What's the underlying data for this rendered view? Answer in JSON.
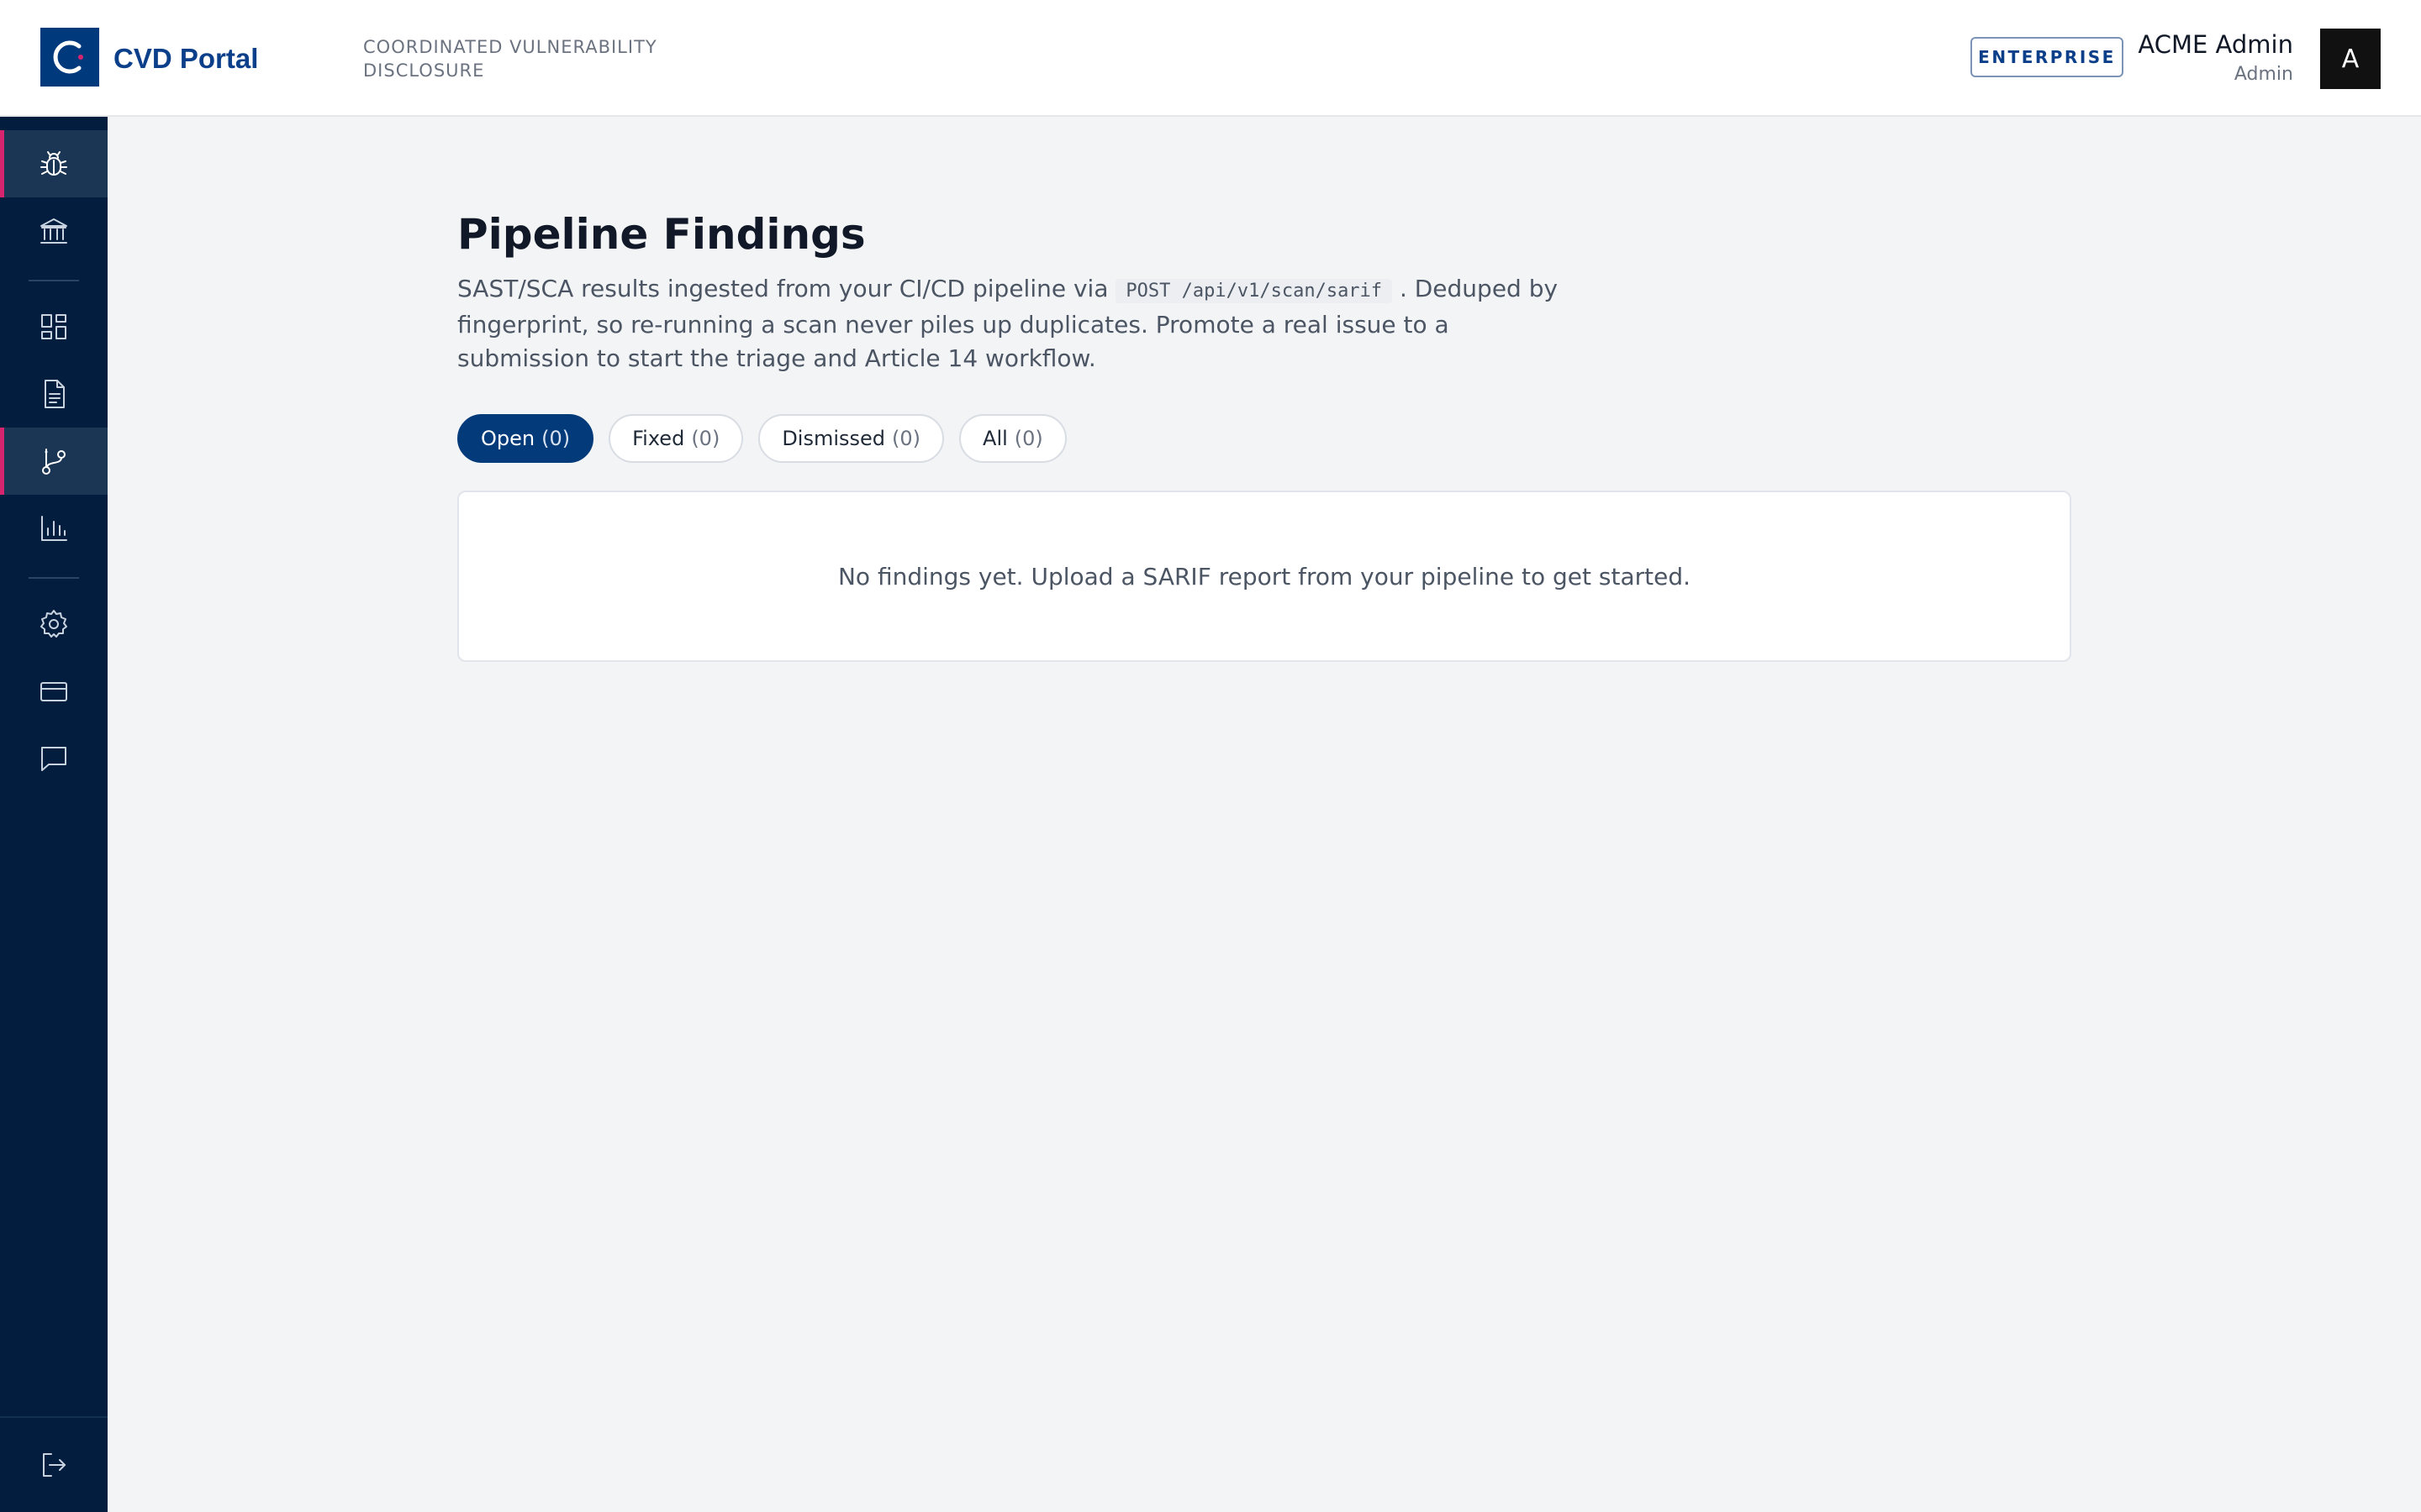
{
  "header": {
    "app_name": "CVD Portal",
    "tagline": "COORDINATED VULNERABILITY DISCLOSURE",
    "plan_badge": "ENTERPRISE",
    "user_name": "ACME Admin",
    "user_role": "Admin",
    "avatar_initial": "A"
  },
  "sidebar": {
    "items": [
      {
        "id": "vulnerabilities",
        "icon": "bug-icon",
        "active": true
      },
      {
        "id": "disclosure",
        "icon": "institution-icon",
        "active": false
      },
      {
        "id": "dashboard",
        "icon": "dashboard-icon",
        "active": false
      },
      {
        "id": "reports",
        "icon": "document-icon",
        "active": false
      },
      {
        "id": "pipeline",
        "icon": "git-branch-icon",
        "active": true
      },
      {
        "id": "analytics",
        "icon": "bar-chart-icon",
        "active": false
      },
      {
        "id": "settings",
        "icon": "gear-icon",
        "active": false
      },
      {
        "id": "billing",
        "icon": "credit-card-icon",
        "active": false
      },
      {
        "id": "messages",
        "icon": "chat-icon",
        "active": false
      }
    ],
    "logout_icon": "logout-icon"
  },
  "main": {
    "title": "Pipeline Findings",
    "description_before": "SAST/SCA results ingested from your CI/CD pipeline via ",
    "description_code": "POST /api/v1/scan/sarif",
    "description_after": " . Deduped by fingerprint, so re-running a scan never piles up duplicates. Promote a real issue to a submission to start the triage and Article 14 workflow.",
    "filters": [
      {
        "label": "Open",
        "count": "(0)",
        "active": true
      },
      {
        "label": "Fixed",
        "count": "(0)",
        "active": false
      },
      {
        "label": "Dismissed",
        "count": "(0)",
        "active": false
      },
      {
        "label": "All",
        "count": "(0)",
        "active": false
      }
    ],
    "empty_message": "No findings yet. Upload a SARIF report from your pipeline to get started."
  },
  "colors": {
    "brand": "#003a7d",
    "sidebar_bg": "#021d3e",
    "active_accent": "#d6246e",
    "active_pill": "#023a7a"
  }
}
